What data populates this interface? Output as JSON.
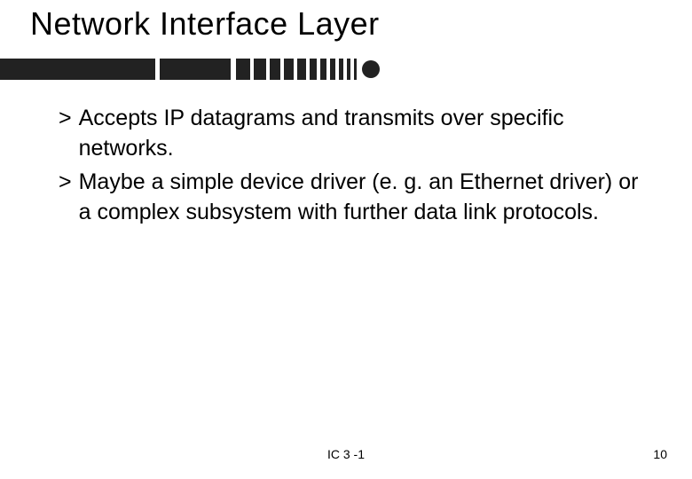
{
  "title": "Network Interface Layer",
  "bullets": [
    {
      "marker": ">",
      "text": "Accepts IP datagrams and transmits over specific networks."
    },
    {
      "marker": ">",
      "text": "Maybe a simple device driver (e. g. an Ethernet driver) or a complex subsystem with further data link protocols."
    }
  ],
  "footer": {
    "center": "IC 3 -1",
    "page": "10"
  }
}
